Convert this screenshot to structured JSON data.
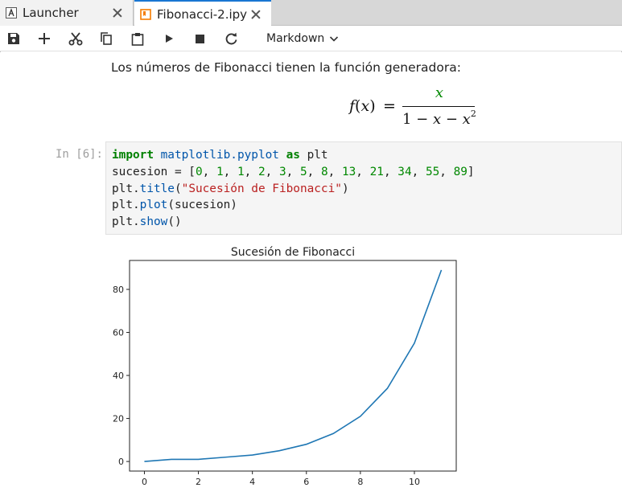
{
  "tabs": [
    {
      "label": "Launcher",
      "icon": "launcher-icon",
      "active": false
    },
    {
      "label": "Fibonacci-2.ipy",
      "icon": "notebook-icon",
      "active": true
    }
  ],
  "toolbar": {
    "buttons": [
      "save-icon",
      "add-cell-icon",
      "cut-icon",
      "copy-icon",
      "paste-icon",
      "run-icon",
      "stop-icon",
      "restart-icon"
    ],
    "cell_type": "Markdown"
  },
  "markdown": {
    "text": "Los números de Fibonacci tienen la función generadora:"
  },
  "code_cell": {
    "prompt": "In [6]:",
    "line1_kw1": "import",
    "line1_mod": " matplotlib.pyplot ",
    "line1_kw2": "as",
    "line1_rest": " plt",
    "line2_prefix": "sucesion = [",
    "line2_values": [
      0,
      1,
      1,
      2,
      3,
      5,
      8,
      13,
      21,
      34,
      55,
      89
    ],
    "line3_prefix": "plt.",
    "line3_fn": "title",
    "line3_str": "\"Sucesión de Fibonacci\"",
    "line4_prefix": "plt.",
    "line4_fn": "plot",
    "line4_args": "(sucesion)",
    "line5_prefix": "plt.",
    "line5_fn": "show",
    "line5_args": "()"
  },
  "colors": {
    "accent": "#1976d2",
    "line": "#1f77b4",
    "notebook_icon": "#f57c00"
  },
  "chart_data": {
    "type": "line",
    "title": "Sucesión de Fibonacci",
    "x": [
      0,
      1,
      2,
      3,
      4,
      5,
      6,
      7,
      8,
      9,
      10,
      11
    ],
    "series": [
      {
        "values": [
          0,
          1,
          1,
          2,
          3,
          5,
          8,
          13,
          21,
          34,
          55,
          89
        ]
      }
    ],
    "xticks": [
      0,
      2,
      4,
      6,
      8,
      10
    ],
    "yticks": [
      0,
      20,
      40,
      60,
      80
    ],
    "xlim": [
      -0.55,
      11.55
    ],
    "ylim": [
      -4.45,
      93.45
    ],
    "xlabel": "",
    "ylabel": "",
    "grid": false
  }
}
